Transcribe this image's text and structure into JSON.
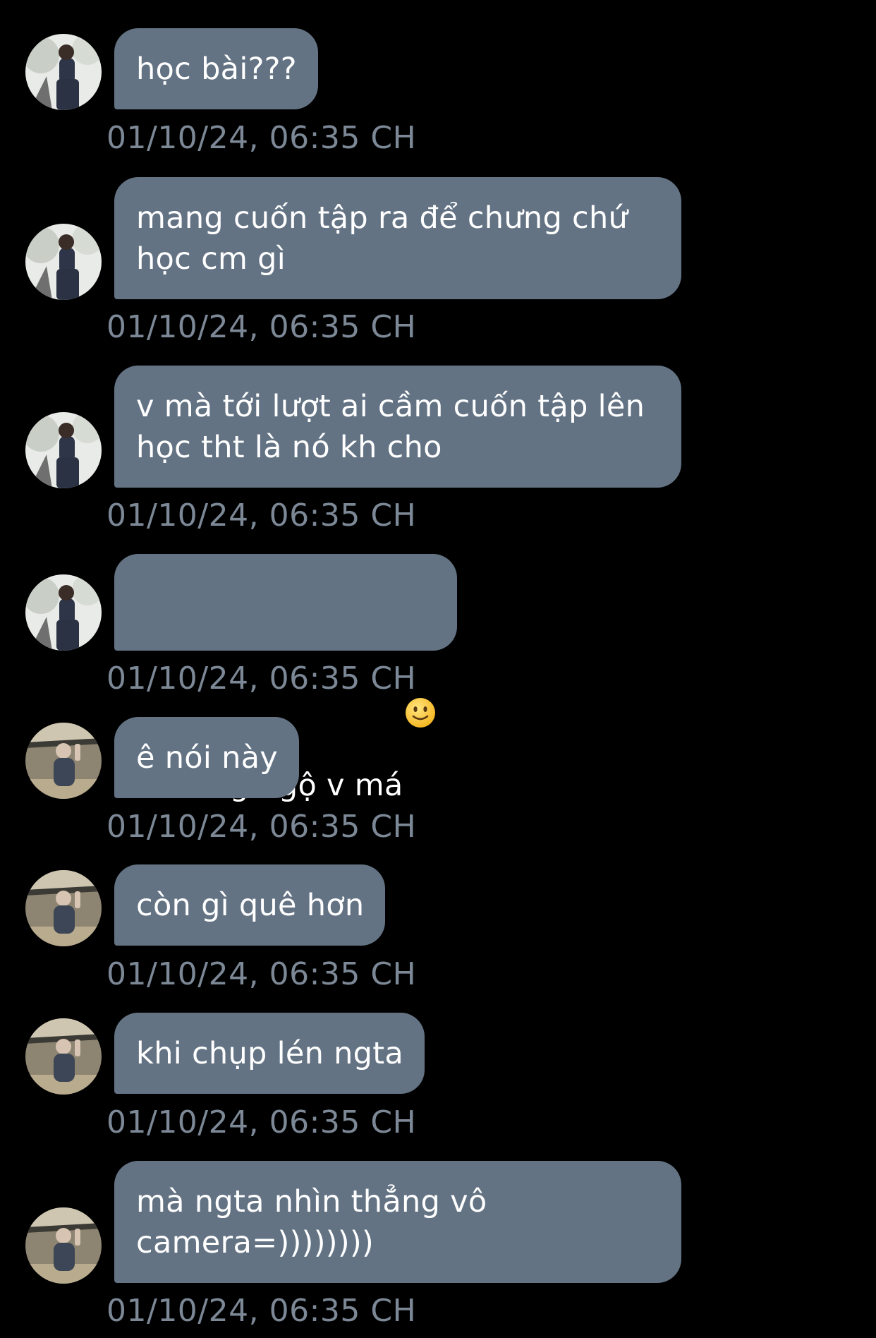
{
  "messages": [
    {
      "text": "học bài???",
      "time": "01/10/24, 06:35 CH",
      "avatar": "avatar-1"
    },
    {
      "text": "mang cuốn tập ra để chưng chứ\nhọc cm gì",
      "time": "01/10/24, 06:35 CH",
      "avatar": "avatar-1"
    },
    {
      "text": "v mà tới lượt ai cầm cuốn tập lên\nhọc tht là nó kh cho",
      "time": "01/10/24, 06:35 CH",
      "avatar": "avatar-1"
    },
    {
      "text": "sống ngộ v má",
      "emoji": "slightly-smiling-face-icon",
      "time": "01/10/24, 06:35 CH",
      "avatar": "avatar-1"
    },
    {
      "text": "ê nói này",
      "time": "01/10/24, 06:35 CH",
      "avatar": "avatar-2"
    },
    {
      "text": "còn gì quê hơn",
      "time": "01/10/24, 06:35 CH",
      "avatar": "avatar-2"
    },
    {
      "text": "khi chụp lén ngta",
      "time": "01/10/24, 06:35 CH",
      "avatar": "avatar-2"
    },
    {
      "text": "mà ngta nhìn thẳng vô\ncamera=))))))))",
      "time": "01/10/24, 06:35 CH",
      "avatar": "avatar-2"
    }
  ],
  "colors": {
    "background": "#000000",
    "bubble": "#637384",
    "bubble_text": "#ffffff",
    "timestamp": "#7c8896"
  }
}
